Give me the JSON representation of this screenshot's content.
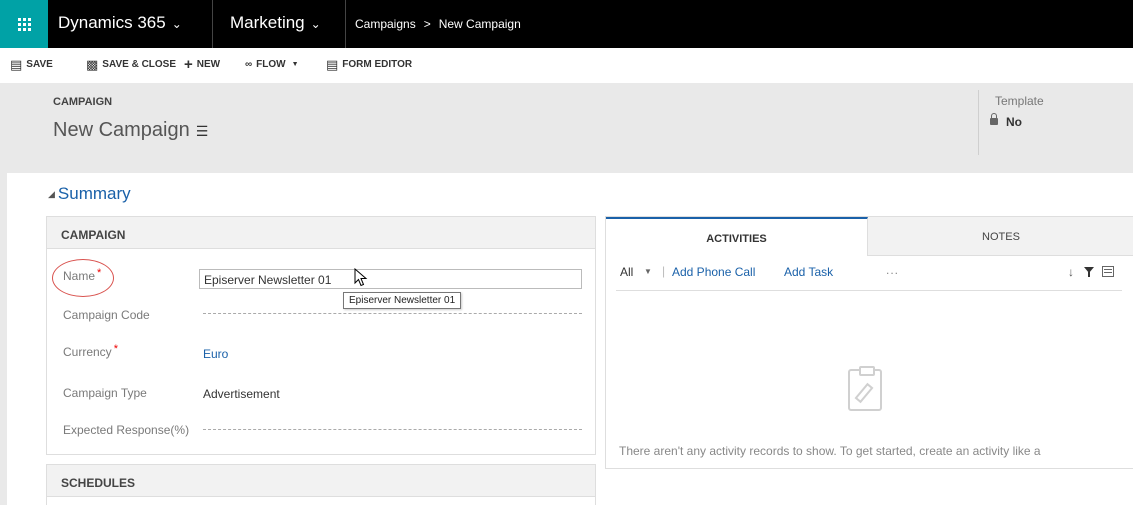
{
  "nav": {
    "app_name": "Dynamics 365",
    "area_name": "Marketing",
    "breadcrumb_parent": "Campaigns",
    "breadcrumb_current": "New Campaign"
  },
  "commands": {
    "save": "SAVE",
    "save_close": "SAVE & CLOSE",
    "new": "NEW",
    "flow": "FLOW",
    "form_editor": "FORM EDITOR"
  },
  "header": {
    "entity": "CAMPAIGN",
    "title": "New Campaign",
    "template_label": "Template",
    "template_value": "No"
  },
  "summary": {
    "label": "Summary"
  },
  "campaign_section": {
    "title": "CAMPAIGN",
    "name_label": "Name",
    "name_value": "Episerver Newsletter 01",
    "name_tooltip": "Episerver Newsletter 01",
    "code_label": "Campaign Code",
    "currency_label": "Currency",
    "currency_value": "Euro",
    "type_label": "Campaign Type",
    "type_value": "Advertisement",
    "response_label": "Expected Response(%)"
  },
  "schedules_section": {
    "title": "SCHEDULES"
  },
  "activities": {
    "tab_activities": "ACTIVITIES",
    "tab_notes": "NOTES",
    "filter_all": "All",
    "add_phone_call": "Add Phone Call",
    "add_task": "Add Task",
    "more": "...",
    "empty_message": "There aren't any activity records to show. To get started, create an activity like a"
  },
  "colors": {
    "nav_bg": "#000000",
    "waffle_bg": "#00a2a6",
    "link": "#1a61a9",
    "band_bg": "#e9e9e9",
    "required": "#e00000",
    "highlight_circle": "#d9534f"
  }
}
